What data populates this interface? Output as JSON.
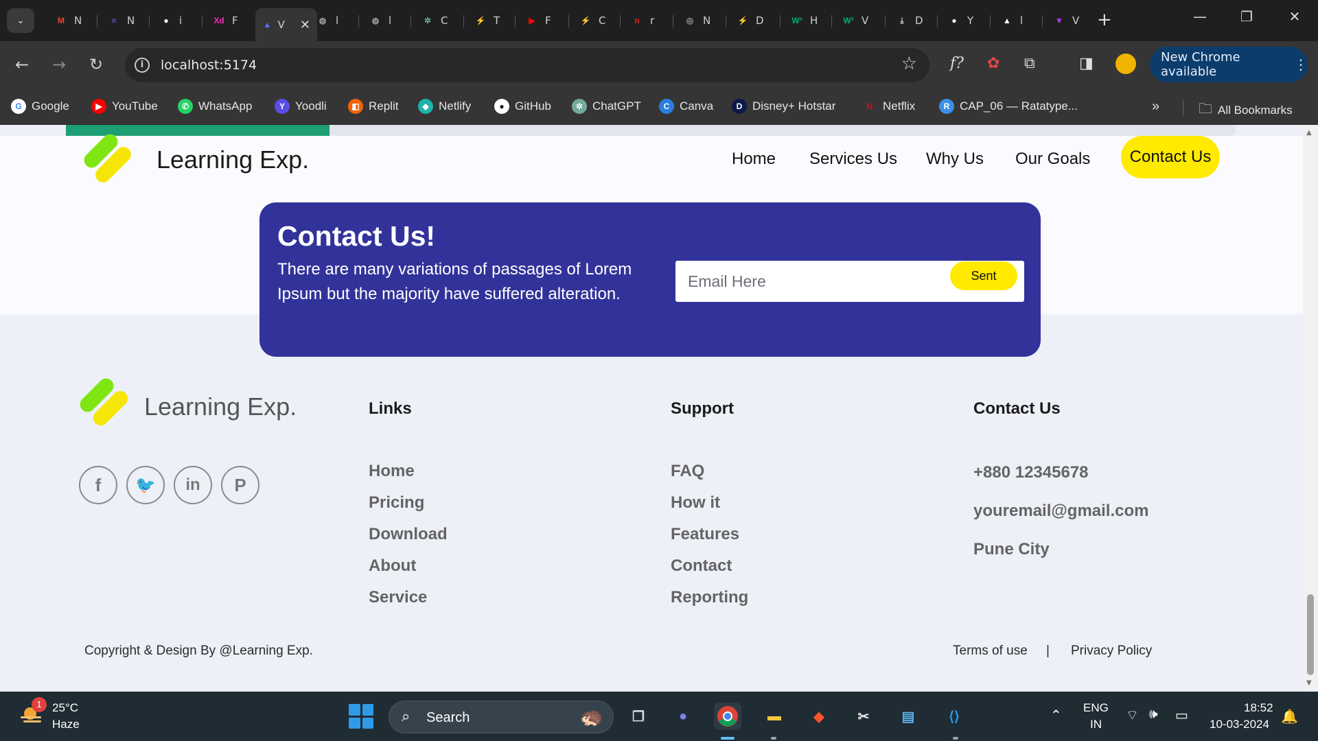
{
  "browser": {
    "tabs": [
      {
        "label": "N",
        "icon": "gmail-icon",
        "color": "#ea4335",
        "glyph": "M"
      },
      {
        "label": "N",
        "icon": "list-icon",
        "color": "#6b5ce7",
        "glyph": "≡"
      },
      {
        "label": "i",
        "icon": "github-icon",
        "color": "#ffffff",
        "glyph": "●"
      },
      {
        "label": "F",
        "icon": "xd-icon",
        "color": "#ff26be",
        "glyph": "Xd"
      },
      {
        "label": "V",
        "icon": "vite-icon",
        "color": "#646cff",
        "glyph": "▲",
        "active": true
      },
      {
        "label": "l",
        "icon": "globe-icon",
        "color": "#9aa0a6",
        "glyph": "◍"
      },
      {
        "label": "l",
        "icon": "globe-icon",
        "color": "#9aa0a6",
        "glyph": "◍"
      },
      {
        "label": "C",
        "icon": "chatgpt-icon",
        "color": "#74aa9c",
        "glyph": "✲"
      },
      {
        "label": "T",
        "icon": "bolt-icon",
        "color": "#2bb3a0",
        "glyph": "⚡"
      },
      {
        "label": "F",
        "icon": "youtube-icon",
        "color": "#ff0000",
        "glyph": "▶"
      },
      {
        "label": "C",
        "icon": "bolt-icon",
        "color": "#2bb3a0",
        "glyph": "⚡"
      },
      {
        "label": "r",
        "icon": "n-icon",
        "color": "#e02020",
        "glyph": "n"
      },
      {
        "label": "N",
        "icon": "chrome-icon",
        "color": "#9aa0a6",
        "glyph": "◎"
      },
      {
        "label": "D",
        "icon": "bolt-icon",
        "color": "#2bb3a0",
        "glyph": "⚡"
      },
      {
        "label": "H",
        "icon": "w3-icon",
        "color": "#04aa6d",
        "glyph": "W³"
      },
      {
        "label": "V",
        "icon": "w3-icon",
        "color": "#04aa6d",
        "glyph": "W³"
      },
      {
        "label": "D",
        "icon": "download-icon",
        "color": "#cccccc",
        "glyph": "⤓"
      },
      {
        "label": "Y",
        "icon": "github-icon",
        "color": "#ffffff",
        "glyph": "●"
      },
      {
        "label": "l",
        "icon": "triangle-icon",
        "color": "#ffffff",
        "glyph": "▲"
      },
      {
        "label": "V",
        "icon": "vite-icon",
        "color": "#bd34fe",
        "glyph": "▼"
      }
    ],
    "url": "localhost:5174",
    "update_label": "New Chrome available",
    "bookmarks": [
      {
        "label": "Google",
        "icon": "google-icon",
        "color": "#ffffff",
        "glyph": "G",
        "fg": "#4285f4"
      },
      {
        "label": "YouTube",
        "icon": "youtube-icon",
        "color": "#ff0000",
        "glyph": "▶",
        "fg": "#ffffff"
      },
      {
        "label": "WhatsApp",
        "icon": "whatsapp-icon",
        "color": "#25d366",
        "glyph": "✆",
        "fg": "#ffffff"
      },
      {
        "label": "Yoodli",
        "icon": "yoodli-icon",
        "color": "#5b4de8",
        "glyph": "Y",
        "fg": "#ffffff"
      },
      {
        "label": "Replit",
        "icon": "replit-icon",
        "color": "#f26207",
        "glyph": "◧",
        "fg": "#ffffff"
      },
      {
        "label": "Netlify",
        "icon": "netlify-icon",
        "color": "#20b2aa",
        "glyph": "◆",
        "fg": "#ffffff"
      },
      {
        "label": "GitHub",
        "icon": "github-icon",
        "color": "#ffffff",
        "glyph": "●",
        "fg": "#111111"
      },
      {
        "label": "ChatGPT",
        "icon": "chatgpt-icon",
        "color": "#74aa9c",
        "glyph": "✲",
        "fg": "#ffffff"
      },
      {
        "label": "Canva",
        "icon": "canva-icon",
        "color": "#2a7de1",
        "glyph": "C",
        "fg": "#ffffff"
      },
      {
        "label": "Disney+ Hotstar",
        "icon": "hotstar-icon",
        "color": "#0c1a4a",
        "glyph": "D",
        "fg": "#ffffff"
      },
      {
        "label": "Netflix",
        "icon": "netflix-icon",
        "color": "#353535",
        "glyph": "N",
        "fg": "#e50914"
      },
      {
        "label": "CAP_06 — Ratatype...",
        "icon": "ratatype-icon",
        "color": "#3b8fe8",
        "glyph": "R",
        "fg": "#ffffff"
      }
    ],
    "all_bookmarks": "All Bookmarks"
  },
  "page": {
    "brand": "Learning Exp.",
    "nav": [
      "Home",
      "Services Us",
      "Why Us",
      "Our Goals"
    ],
    "contact_button": "Contact Us",
    "contact": {
      "title": "Contact Us!",
      "description": "There are many variations of passages of Lorem Ipsum but the majority have suffered alteration.",
      "email_placeholder": "Email Here",
      "send_label": "Sent"
    },
    "footer": {
      "brand": "Learning Exp.",
      "social": [
        {
          "glyph": "f",
          "icon": "facebook-icon"
        },
        {
          "glyph": "🐦",
          "icon": "twitter-icon"
        },
        {
          "glyph": "in",
          "icon": "linkedin-icon"
        },
        {
          "glyph": "P",
          "icon": "pinterest-icon"
        }
      ],
      "columns": [
        {
          "heading": "Links",
          "items": [
            "Home",
            "Pricing",
            "Download",
            "About",
            "Service"
          ]
        },
        {
          "heading": "Support",
          "items": [
            "FAQ",
            "How it",
            "Features",
            "Contact",
            "Reporting"
          ]
        },
        {
          "heading": "Contact Us",
          "items": [
            "+880 12345678",
            "youremail@gmail.com",
            "Pune City"
          ]
        }
      ],
      "copyright": "Copyright & Design By @Learning Exp.",
      "terms": "Terms of use",
      "separator": "|",
      "privacy": "Privacy Policy"
    },
    "colors": {
      "accent": "#ffea00",
      "card": "#32339a",
      "logo_green": "#7fe614",
      "logo_yellow": "#f6e608"
    }
  },
  "taskbar": {
    "temp": "25°C",
    "weather": "Haze",
    "badge": "1",
    "search": "Search",
    "lang1": "ENG",
    "lang2": "IN",
    "time": "18:52",
    "date": "10-03-2024"
  }
}
